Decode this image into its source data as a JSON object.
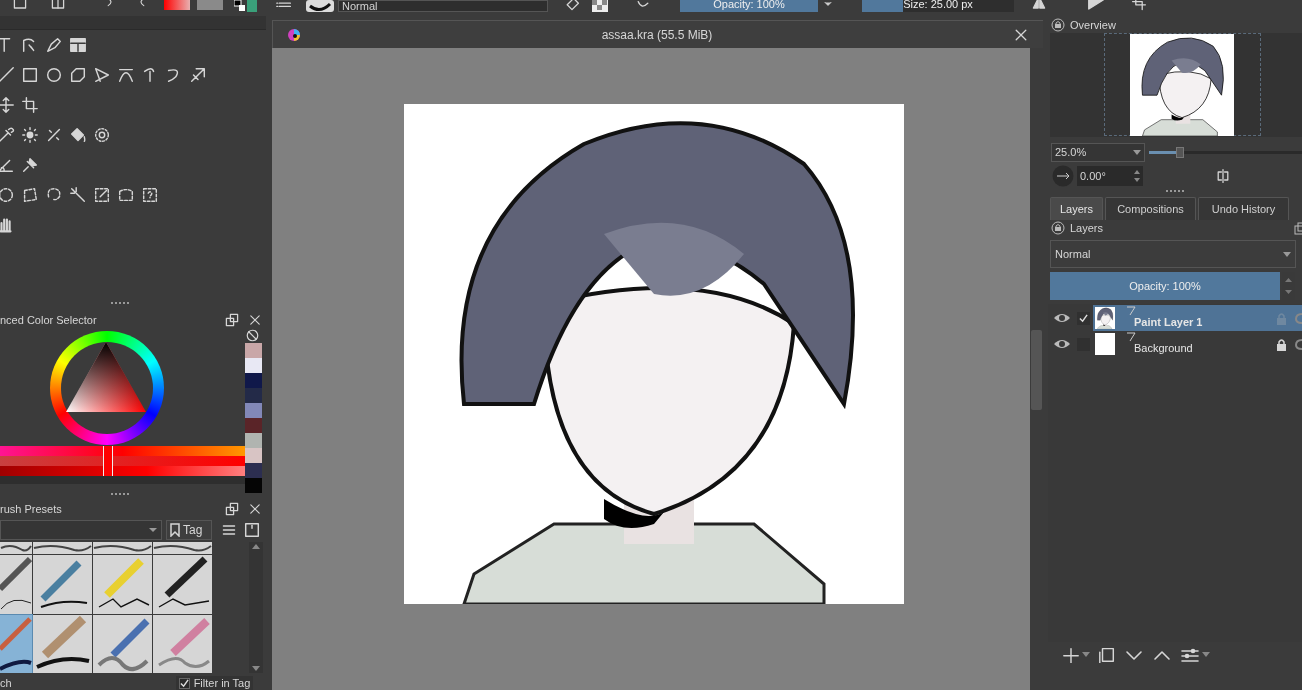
{
  "toolbar": {
    "blend_mode": "Normal",
    "opacity": {
      "label": "Opacity: 100%",
      "level": 1
    },
    "size": {
      "label": "Size: 25.00 px",
      "level": 0.27
    }
  },
  "color_selector": {
    "title": "nced Color Selector",
    "sliders": [
      {
        "level": 0.44
      },
      {
        "level": 0.44
      },
      {
        "level": 0.44
      }
    ],
    "recent_colors": [
      {
        "color": "#c9a7a8"
      },
      {
        "color": "#e8e8f4"
      },
      {
        "color": "#10184a"
      },
      {
        "color": "#232a48"
      },
      {
        "color": "#8288b8"
      },
      {
        "color": "#5a2428"
      },
      {
        "color": "#b0b4b0"
      },
      {
        "color": "#d8c4c4"
      },
      {
        "color": "#2c2e50"
      },
      {
        "color": "#050505"
      }
    ]
  },
  "brush_presets": {
    "title": "rush Presets",
    "tag_button": "Tag",
    "presets": [
      {
        "selected": false
      },
      {
        "selected": false
      },
      {
        "selected": false
      },
      {
        "selected": false
      },
      {
        "selected": false
      },
      {
        "selected": false
      },
      {
        "selected": false
      },
      {
        "selected": false
      },
      {
        "selected": true
      },
      {
        "selected": false
      },
      {
        "selected": false
      },
      {
        "selected": false
      }
    ],
    "search": "ch",
    "filter_in_tag": {
      "label": "Filter in Tag",
      "checked": true
    }
  },
  "document": {
    "title": "assaa.kra (55.5 MiB)"
  },
  "overview": {
    "title": "Overview",
    "zoom": "25.0%",
    "zoom_slider": {
      "level": 0.2
    },
    "rotation": "0.00°"
  },
  "docker_tabs": [
    {
      "label": "Layers",
      "selected": true
    },
    {
      "label": "Compositions",
      "selected": false
    },
    {
      "label": "Undo History",
      "selected": false
    }
  ],
  "layers_panel": {
    "title": "Layers",
    "blend_mode": "Normal",
    "opacity": {
      "label": "Opacity: 100%",
      "level": 1
    },
    "layers": [
      {
        "name": "Paint Layer 1",
        "visible": true,
        "selected": true,
        "checked": true,
        "locked": false
      },
      {
        "name": "Background",
        "visible": true,
        "selected": false,
        "checked": false,
        "locked": true
      }
    ]
  }
}
